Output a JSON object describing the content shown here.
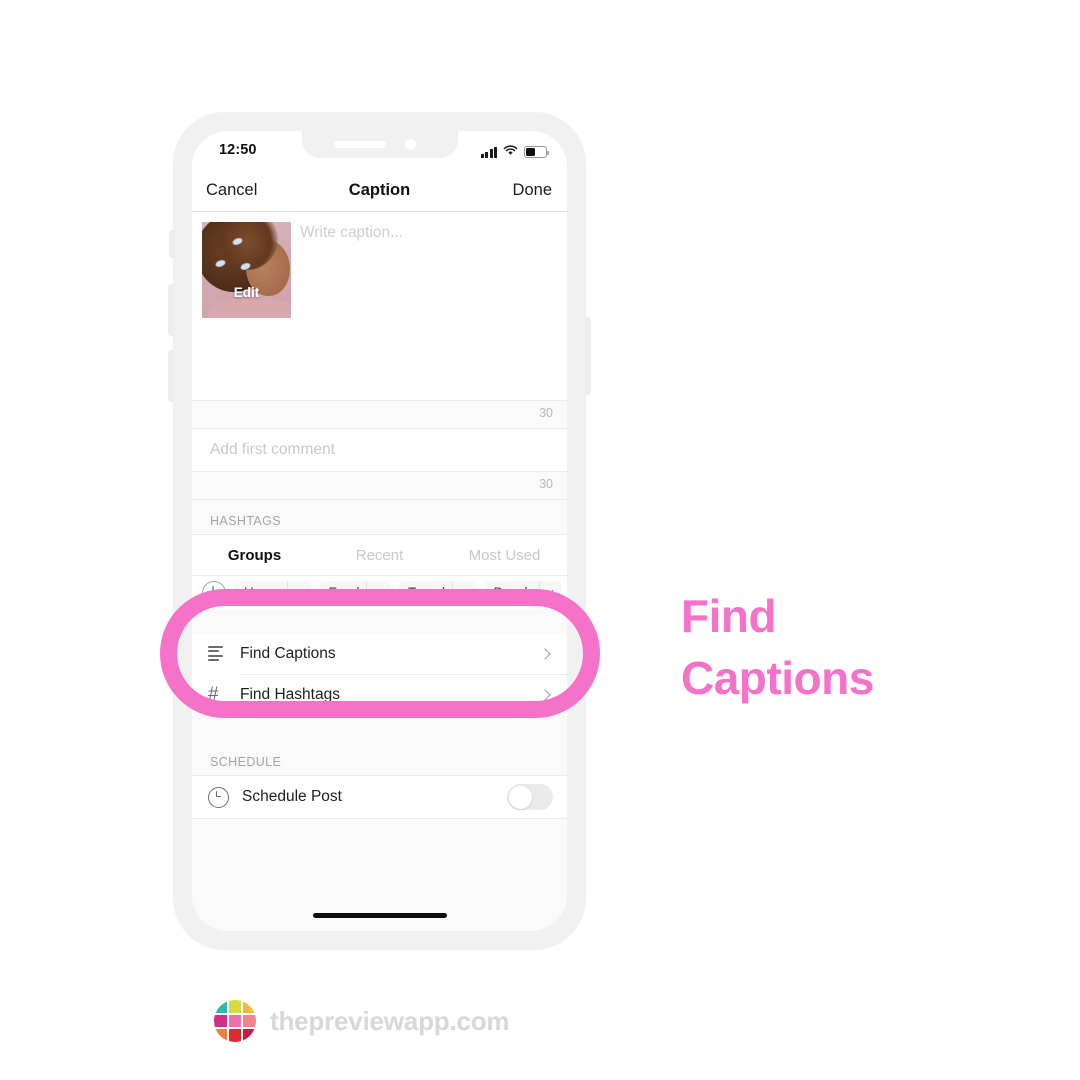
{
  "status_bar": {
    "time": "12:50",
    "signal_icon": "signal-bars-icon",
    "wifi_icon": "wifi-icon",
    "battery_icon": "battery-icon"
  },
  "nav_bar": {
    "cancel_label": "Cancel",
    "title": "Caption",
    "done_label": "Done"
  },
  "caption": {
    "placeholder": "Write caption...",
    "thumbnail_edit_label": "Edit",
    "caption_counter": "30",
    "comment_placeholder": "Add first comment",
    "comment_counter": "30"
  },
  "hashtags": {
    "section_label": "HASHTAGS",
    "tabs": [
      {
        "label": "Groups",
        "active": true
      },
      {
        "label": "Recent",
        "active": false
      },
      {
        "label": "Most Used",
        "active": false
      }
    ],
    "add_icon": "plus-circle-icon",
    "chips": [
      {
        "label": "Home",
        "remove": "×"
      },
      {
        "label": "Food",
        "remove": "×"
      },
      {
        "label": "Travel",
        "remove": "×"
      },
      {
        "label": "Beach",
        "remove": "×"
      }
    ]
  },
  "find_list": [
    {
      "label": "Find Captions",
      "icon": "list-lines-icon",
      "chevron": "chevron-right-icon"
    },
    {
      "label": "Find Hashtags",
      "icon": "hash-icon",
      "chevron": "chevron-right-icon"
    }
  ],
  "schedule": {
    "section_label": "SCHEDULE",
    "row_label": "Schedule Post",
    "icon": "clock-icon",
    "toggle_state": "off"
  },
  "annotation": {
    "line1": "Find",
    "line2": "Captions",
    "color": "#f472c8"
  },
  "branding": {
    "text": "thepreviewapp.com",
    "logo_icon": "preview-app-grid-logo",
    "logo_colors": [
      "#2fb9a8",
      "#d8dc3a",
      "#f5b73c",
      "#cf2f86",
      "#ef6fa8",
      "#f2848f",
      "#ef7f3e",
      "#e02a2f",
      "#c9184a"
    ],
    "text_color": "#d8d8d8"
  },
  "colors": {
    "accent_pink": "#f472c8",
    "frame_gray": "#f1f1f1",
    "screen_bg": "#fafafa"
  }
}
